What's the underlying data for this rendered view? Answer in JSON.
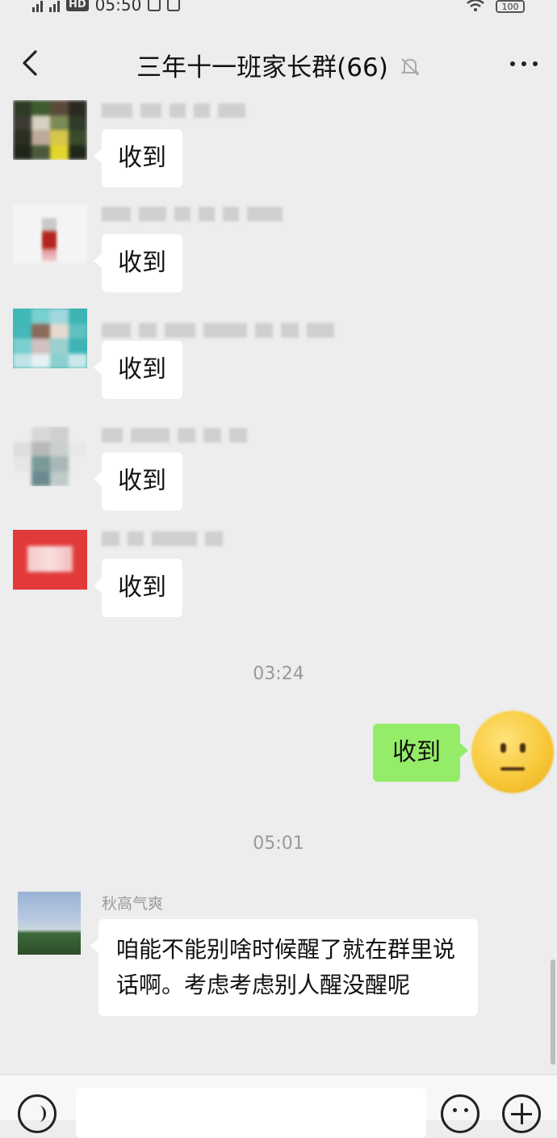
{
  "status_bar": {
    "time": "05:50",
    "battery": "100"
  },
  "header": {
    "title": "三年十一班家长群(66)"
  },
  "messages": [
    {
      "text": "收到"
    },
    {
      "text": "收到"
    },
    {
      "text": "收到"
    },
    {
      "text": "收到"
    },
    {
      "text": "收到"
    }
  ],
  "timestamps": [
    "03:24",
    "05:01"
  ],
  "my_message": {
    "text": "收到"
  },
  "last_message": {
    "sender": "秋高气爽",
    "text": "咱能不能别啥时候醒了就在群里说话啊。考虑考虑别人醒没醒呢"
  },
  "colors": {
    "background": "#ededed",
    "my_bubble": "#95ec69",
    "other_bubble": "#ffffff"
  }
}
